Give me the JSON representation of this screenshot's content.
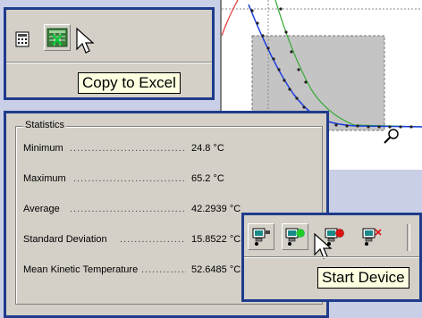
{
  "excel_toolbar": {
    "tooltip": "Copy to Excel",
    "buttons": [
      {
        "icon": "calculator-icon"
      },
      {
        "icon": "excel-icon"
      }
    ]
  },
  "statistics": {
    "legend": "Statistics",
    "rows": [
      {
        "label": "Minimum",
        "value": "24.8 °C"
      },
      {
        "label": "Maximum",
        "value": "65.2 °C"
      },
      {
        "label": "Average",
        "value": "42.2939 °C"
      },
      {
        "label": "Standard Deviation",
        "value": "15.8522 °C"
      },
      {
        "label": "Mean Kinetic Temperature",
        "value": "52.6485 °C"
      }
    ]
  },
  "device_toolbar": {
    "tooltip": "Start Device",
    "buttons": [
      {
        "icon": "device-icon"
      },
      {
        "icon": "device-start-icon"
      },
      {
        "icon": "device-stop-icon"
      },
      {
        "icon": "device-remove-icon"
      }
    ]
  },
  "colors": {
    "panel_border": "#1f3b8c",
    "start_green": "#22cc22",
    "stop_red": "#dd1111",
    "tooltip_bg": "#ffffe1"
  }
}
